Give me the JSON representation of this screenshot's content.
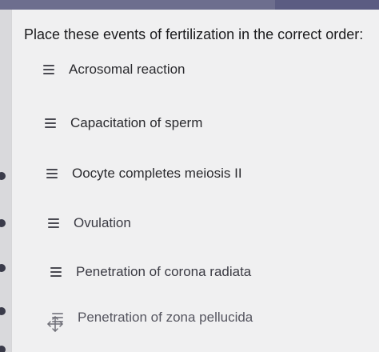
{
  "question": {
    "prompt": "Place these events of fertilization in the correct order:"
  },
  "items": [
    {
      "label": "Acrosomal reaction"
    },
    {
      "label": "Capacitation of sperm"
    },
    {
      "label": "Oocyte completes meiosis II"
    },
    {
      "label": "Ovulation"
    },
    {
      "label": "Penetration of corona radiata"
    },
    {
      "label": "Penetration of zona pellucida"
    }
  ],
  "icons": {
    "handle": "drag-handle-icon",
    "move": "move-arrows-icon"
  },
  "colors": {
    "top_bar": "#6d6e8e",
    "background": "#f0f0f1",
    "text": "#1c1c1e"
  }
}
